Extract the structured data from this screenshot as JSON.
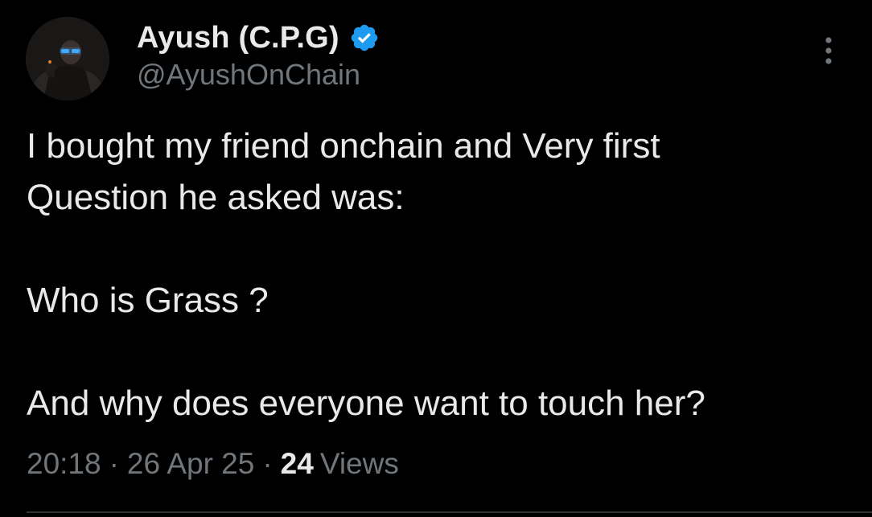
{
  "author": {
    "display_name": "Ayush (C.P.G)",
    "handle": "@AyushOnChain",
    "verified": true,
    "avatar_icon": "profile-photo",
    "verified_icon": "verified-badge-icon"
  },
  "actions": {
    "more_icon": "more-vertical-icon"
  },
  "tweet": {
    "text": "I bought my friend onchain and Very first\nQuestion he asked was:\n\nWho is Grass ?\n\nAnd why does everyone want to touch her?"
  },
  "meta": {
    "time": "20:18",
    "separator": "·",
    "date": "26 Apr 25",
    "views_count": "24",
    "views_label": "Views"
  },
  "colors": {
    "background": "#000000",
    "primary_text": "#e7e9ea",
    "secondary_text": "#71767b",
    "verified_blue": "#1d9bf0",
    "divider": "#2f3336"
  }
}
